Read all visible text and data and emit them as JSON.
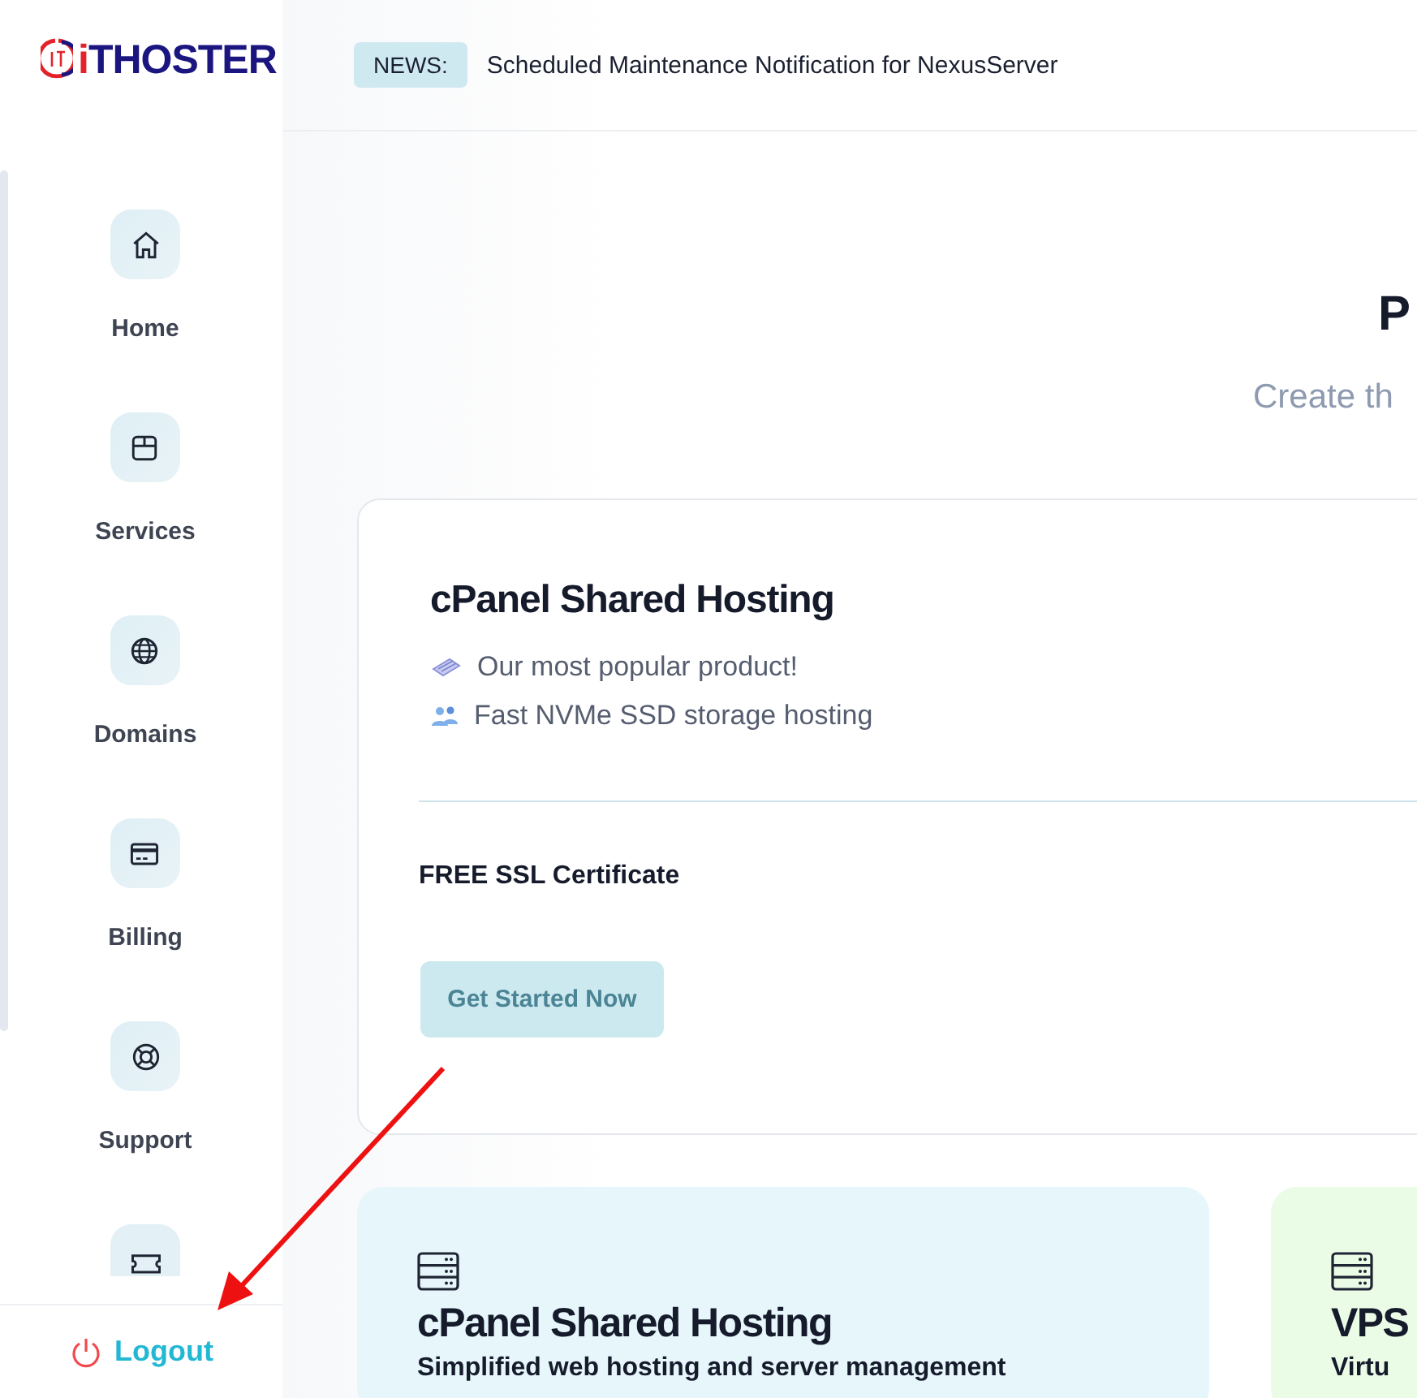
{
  "logo": {
    "text": "iTHOSTER"
  },
  "sidebar": {
    "items": [
      {
        "label": "Home"
      },
      {
        "label": "Services"
      },
      {
        "label": "Domains"
      },
      {
        "label": "Billing"
      },
      {
        "label": "Support"
      }
    ],
    "logout": "Logout"
  },
  "news": {
    "badge": "NEWS:",
    "headline": "Scheduled Maintenance Notification for NexusServer"
  },
  "page": {
    "title": "P",
    "subtitle": "Create th"
  },
  "featured": {
    "title": "cPanel Shared Hosting",
    "features": [
      "Our most popular product!",
      "Fast NVMe SSD storage hosting"
    ],
    "extra": "FREE SSL Certificate",
    "button": "Get Started Now"
  },
  "cards": [
    {
      "title": "cPanel Shared Hosting",
      "description": "Simplified web hosting and server management",
      "color": "#e6f6fb"
    },
    {
      "title": "VPS",
      "description": "Virtu",
      "color": "#eafbe6"
    }
  ]
}
